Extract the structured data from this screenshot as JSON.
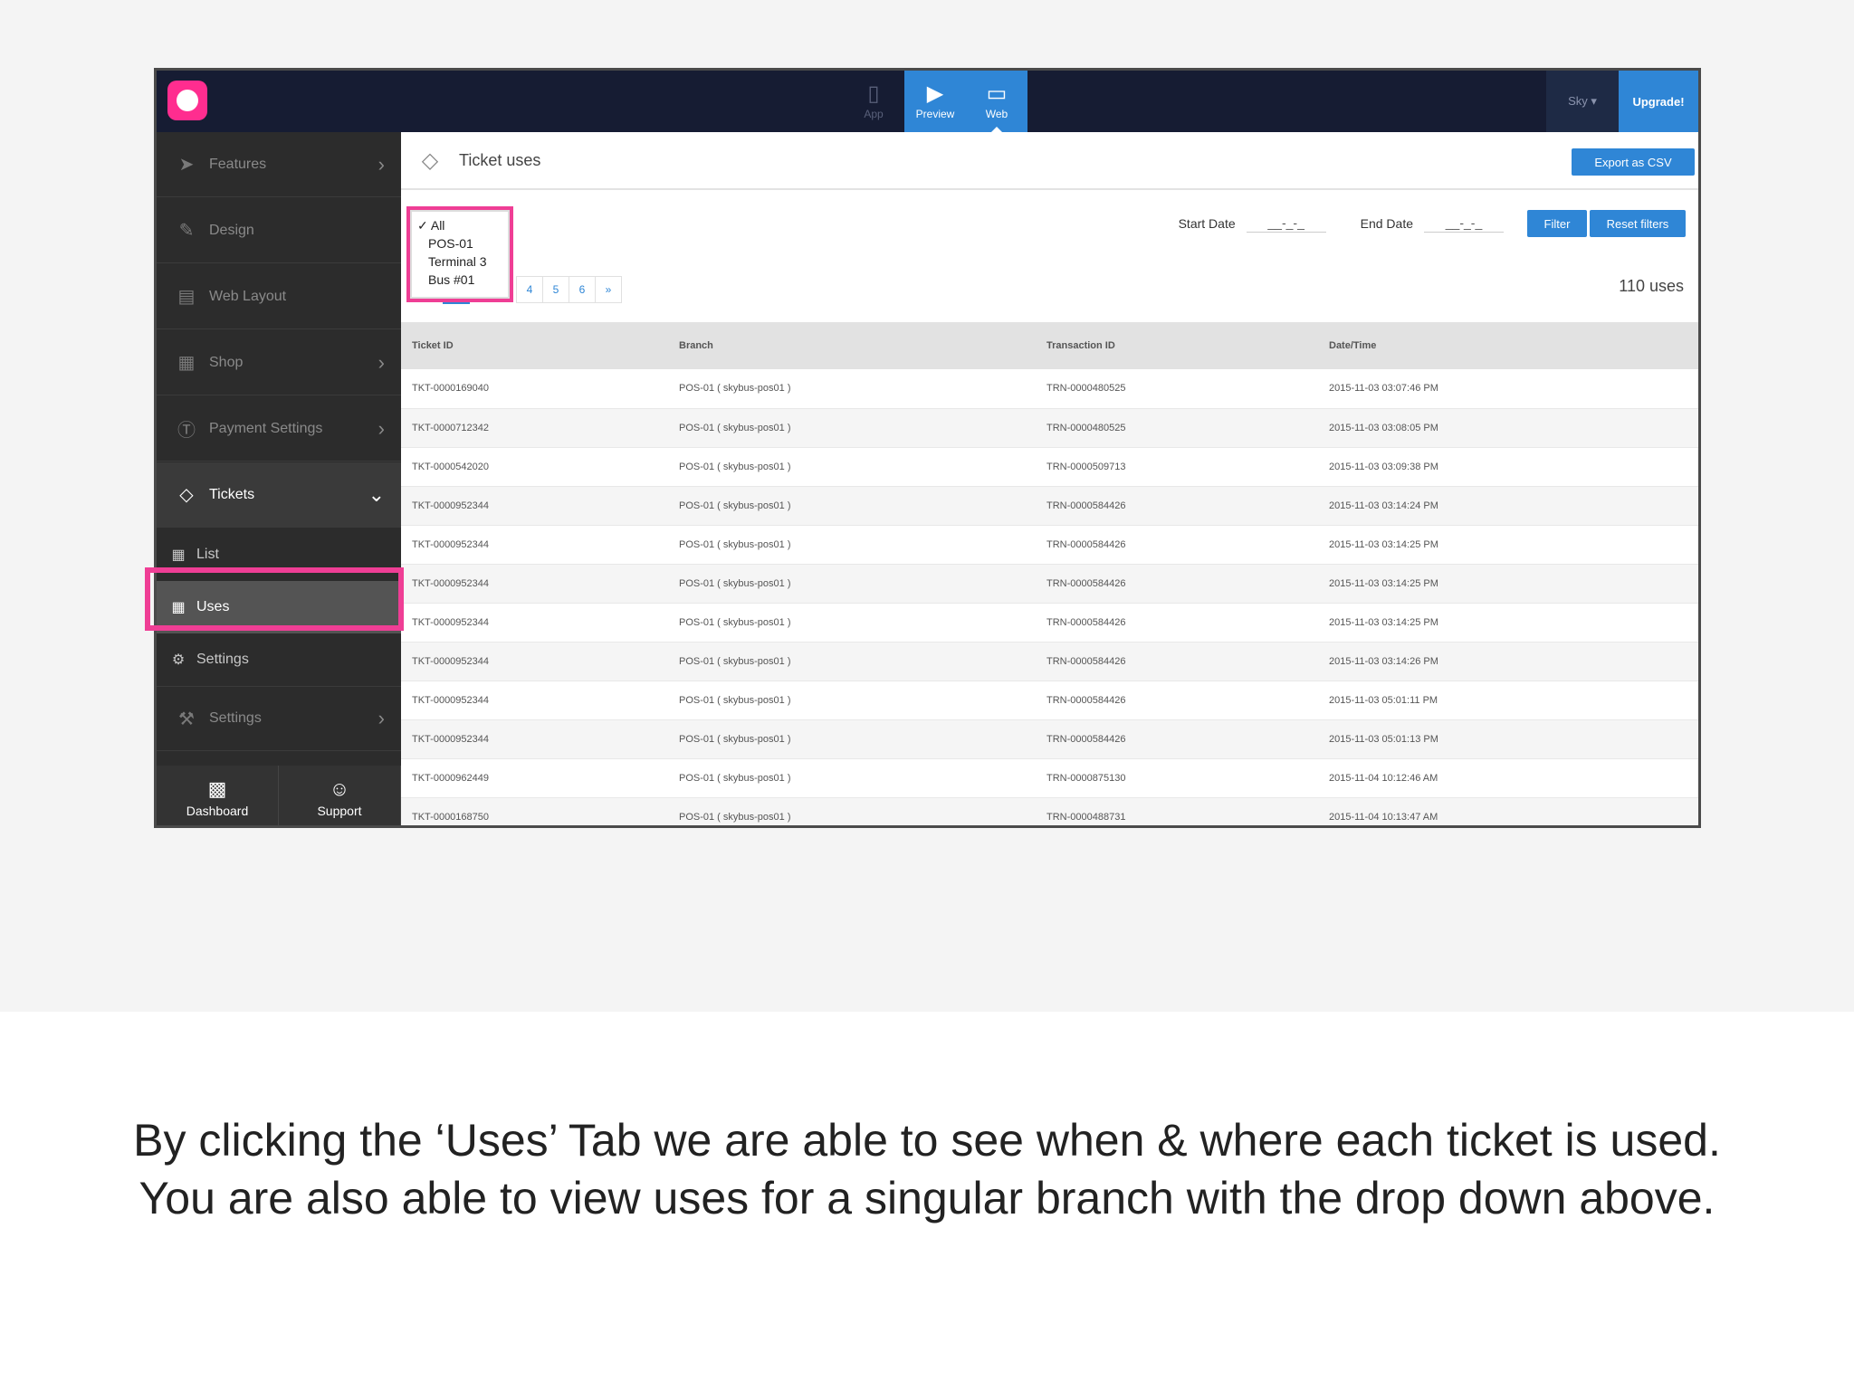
{
  "topbar": {
    "modes": [
      {
        "label": "App",
        "icon": "phone-icon"
      },
      {
        "label": "Preview",
        "icon": "play-icon"
      },
      {
        "label": "Web",
        "icon": "monitor-icon"
      }
    ],
    "user_label": "Sky ▾",
    "upgrade_label": "Upgrade!"
  },
  "sidebar": {
    "items": [
      {
        "label": "Features",
        "icon": "rocket-icon"
      },
      {
        "label": "Design",
        "icon": "pencil-icon"
      },
      {
        "label": "Web Layout",
        "icon": "layout-icon"
      },
      {
        "label": "Shop",
        "icon": "shop-icon"
      },
      {
        "label": "Payment Settings",
        "icon": "dollar-icon"
      },
      {
        "label": "Tickets",
        "icon": "ticket-icon"
      }
    ],
    "sub_items": [
      {
        "label": "List",
        "icon": "grid-icon"
      },
      {
        "label": "Uses",
        "icon": "grid-icon"
      },
      {
        "label": "Settings",
        "icon": "gears-icon"
      }
    ],
    "settings_label": "Settings",
    "bottom": [
      {
        "label": "Dashboard",
        "icon": "chart-icon"
      },
      {
        "label": "Support",
        "icon": "person-icon"
      }
    ]
  },
  "main": {
    "title": "Ticket uses",
    "export_label": "Export as CSV",
    "branch_dropdown": {
      "options": [
        "All",
        "POS-01",
        "Terminal 3",
        "Bus #01"
      ],
      "selected": "All",
      "check": "✓"
    },
    "pages": [
      "4",
      "5",
      "6",
      "»"
    ],
    "start_date_label": "Start Date",
    "start_date_value": "__-_-_",
    "end_date_label": "End Date",
    "end_date_value": "__-_-_",
    "filter_label": "Filter",
    "reset_label": "Reset filters",
    "count": "110 uses",
    "table": {
      "headers": [
        "Ticket ID",
        "Branch",
        "Transaction ID",
        "Date/Time"
      ],
      "rows": [
        [
          "TKT-0000169040",
          "POS-01 ( skybus-pos01 )",
          "TRN-0000480525",
          "2015-11-03 03:07:46 PM"
        ],
        [
          "TKT-0000712342",
          "POS-01 ( skybus-pos01 )",
          "TRN-0000480525",
          "2015-11-03 03:08:05 PM"
        ],
        [
          "TKT-0000542020",
          "POS-01 ( skybus-pos01 )",
          "TRN-0000509713",
          "2015-11-03 03:09:38 PM"
        ],
        [
          "TKT-0000952344",
          "POS-01 ( skybus-pos01 )",
          "TRN-0000584426",
          "2015-11-03 03:14:24 PM"
        ],
        [
          "TKT-0000952344",
          "POS-01 ( skybus-pos01 )",
          "TRN-0000584426",
          "2015-11-03 03:14:25 PM"
        ],
        [
          "TKT-0000952344",
          "POS-01 ( skybus-pos01 )",
          "TRN-0000584426",
          "2015-11-03 03:14:25 PM"
        ],
        [
          "TKT-0000952344",
          "POS-01 ( skybus-pos01 )",
          "TRN-0000584426",
          "2015-11-03 03:14:25 PM"
        ],
        [
          "TKT-0000952344",
          "POS-01 ( skybus-pos01 )",
          "TRN-0000584426",
          "2015-11-03 03:14:26 PM"
        ],
        [
          "TKT-0000952344",
          "POS-01 ( skybus-pos01 )",
          "TRN-0000584426",
          "2015-11-03 05:01:11 PM"
        ],
        [
          "TKT-0000952344",
          "POS-01 ( skybus-pos01 )",
          "TRN-0000584426",
          "2015-11-03 05:01:13 PM"
        ],
        [
          "TKT-0000962449",
          "POS-01 ( skybus-pos01 )",
          "TRN-0000875130",
          "2015-11-04 10:12:46 AM"
        ],
        [
          "TKT-0000168750",
          "POS-01 ( skybus-pos01 )",
          "TRN-0000488731",
          "2015-11-04 10:13:47 AM"
        ]
      ]
    }
  },
  "caption": {
    "line1": "By clicking the ‘Uses’ Tab we are able to see when & where each ticket is used.",
    "line2": "You are also able to view uses for a singular branch with the drop down above."
  },
  "colors": {
    "accent": "#2f86d6",
    "highlight": "#ef3e95",
    "logo": "#ff2d8f",
    "navbar": "#161c33"
  }
}
